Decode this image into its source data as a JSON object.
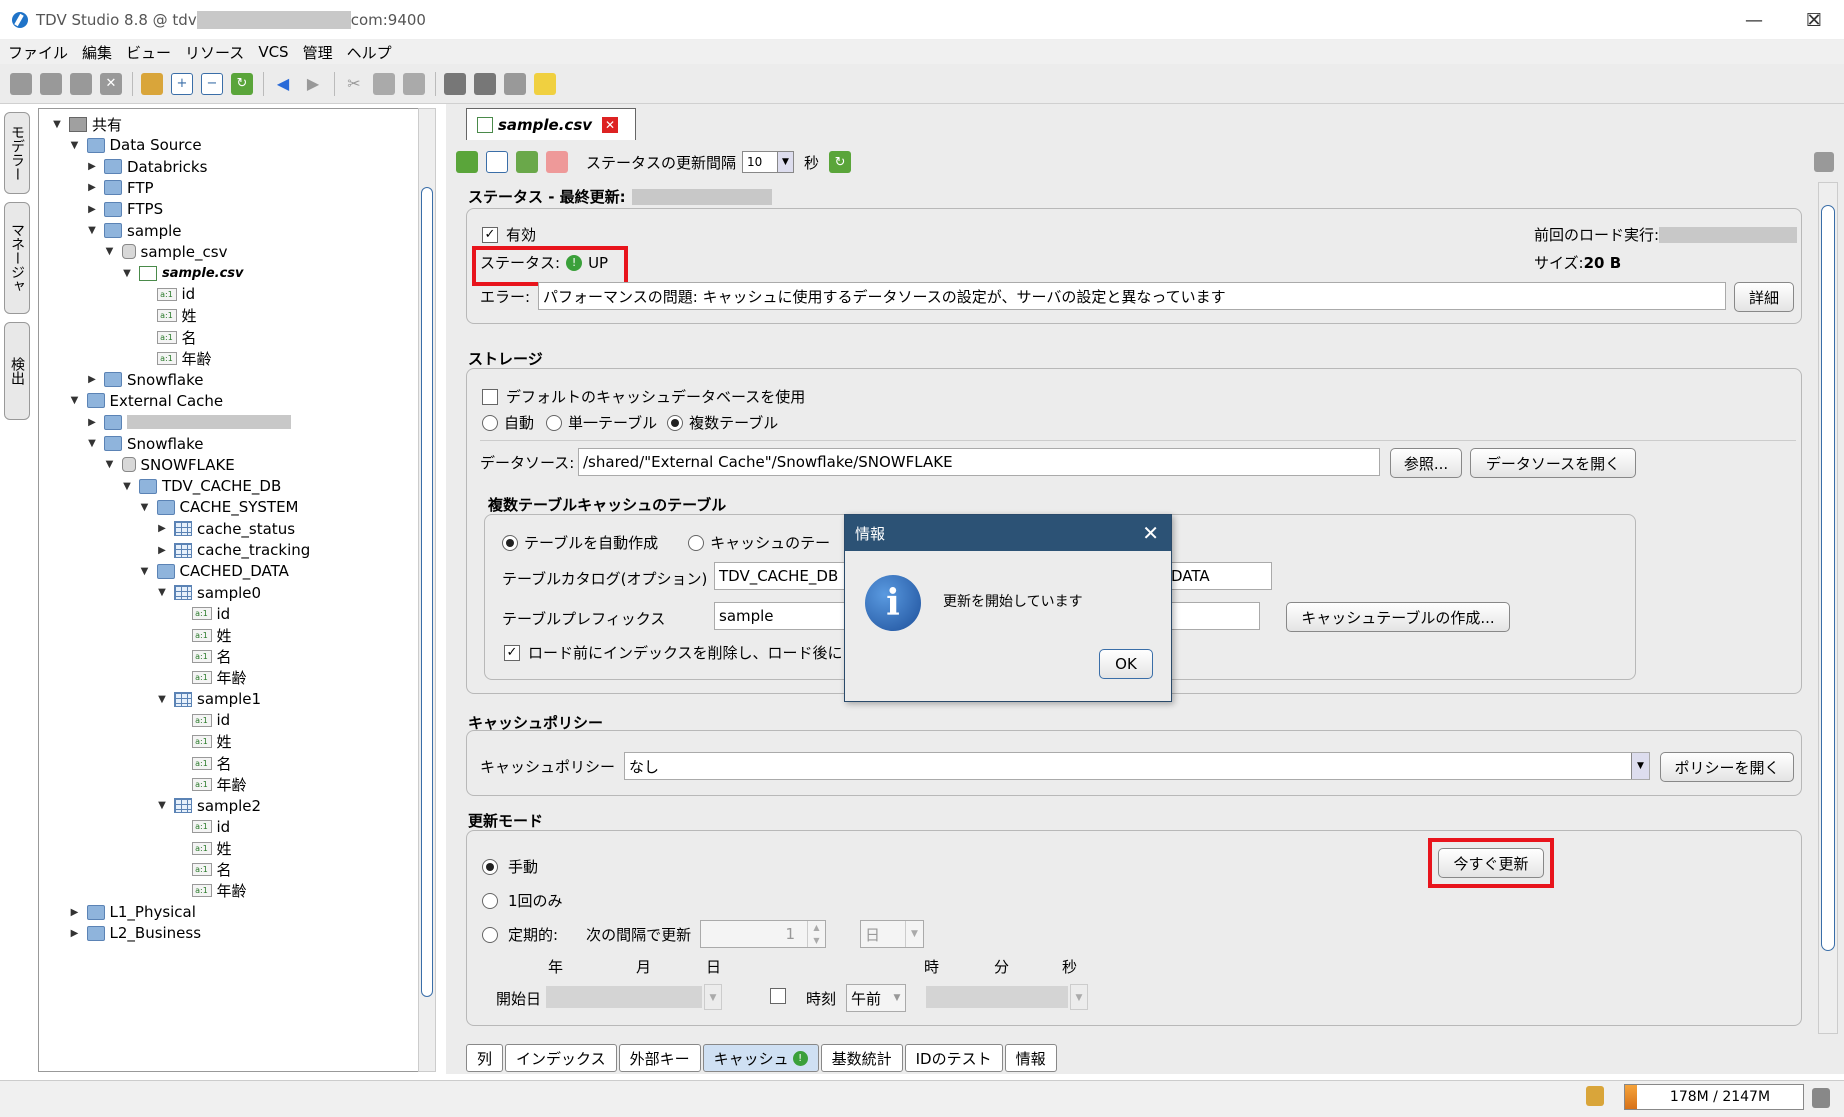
{
  "window": {
    "title_prefix": "TDV Studio 8.8 @ tdv",
    "title_suffix": "com:9400",
    "minimize": "—",
    "maximize": "☐",
    "close": "✕"
  },
  "menu": [
    "ファイル",
    "編集",
    "ビュー",
    "リソース",
    "VCS",
    "管理",
    "ヘルプ"
  ],
  "side_tabs": [
    "モデラー",
    "マネージャ",
    "検出"
  ],
  "tree": [
    {
      "label": "共有",
      "depth": 0,
      "icon": "shared",
      "toggle": "▼"
    },
    {
      "label": "Data Source",
      "depth": 1,
      "icon": "folder",
      "toggle": "▼"
    },
    {
      "label": "Databricks",
      "depth": 2,
      "icon": "folder",
      "toggle": "▶"
    },
    {
      "label": "FTP",
      "depth": 2,
      "icon": "folder",
      "toggle": "▶"
    },
    {
      "label": "FTPS",
      "depth": 2,
      "icon": "folder",
      "toggle": "▶"
    },
    {
      "label": "sample",
      "depth": 2,
      "icon": "folder",
      "toggle": "▼"
    },
    {
      "label": "sample_csv",
      "depth": 3,
      "icon": "db",
      "toggle": "▼"
    },
    {
      "label": "sample.csv",
      "depth": 4,
      "icon": "csv",
      "toggle": "▼",
      "style": "bold-italic"
    },
    {
      "label": "id",
      "depth": 5,
      "icon": "col",
      "toggle": ""
    },
    {
      "label": "姓",
      "depth": 5,
      "icon": "col",
      "toggle": ""
    },
    {
      "label": "名",
      "depth": 5,
      "icon": "col",
      "toggle": ""
    },
    {
      "label": "年齢",
      "depth": 5,
      "icon": "col",
      "toggle": ""
    },
    {
      "label": "Snowflake",
      "depth": 2,
      "icon": "folder",
      "toggle": "▶"
    },
    {
      "label": "External Cache",
      "depth": 1,
      "icon": "folder",
      "toggle": "▼"
    },
    {
      "label": "",
      "depth": 2,
      "icon": "folder",
      "toggle": "▶",
      "redacted": true
    },
    {
      "label": "Snowflake",
      "depth": 2,
      "icon": "folder",
      "toggle": "▼"
    },
    {
      "label": "SNOWFLAKE",
      "depth": 3,
      "icon": "db",
      "toggle": "▼"
    },
    {
      "label": "TDV_CACHE_DB",
      "depth": 4,
      "icon": "folder",
      "toggle": "▼"
    },
    {
      "label": "CACHE_SYSTEM",
      "depth": 5,
      "icon": "folder",
      "toggle": "▼"
    },
    {
      "label": "cache_status",
      "depth": 6,
      "icon": "tbl",
      "toggle": "▶"
    },
    {
      "label": "cache_tracking",
      "depth": 6,
      "icon": "tbl",
      "toggle": "▶"
    },
    {
      "label": "CACHED_DATA",
      "depth": 5,
      "icon": "folder",
      "toggle": "▼"
    },
    {
      "label": "sample0",
      "depth": 6,
      "icon": "tbl",
      "toggle": "▼"
    },
    {
      "label": "id",
      "depth": 7,
      "icon": "col",
      "toggle": ""
    },
    {
      "label": "姓",
      "depth": 7,
      "icon": "col",
      "toggle": ""
    },
    {
      "label": "名",
      "depth": 7,
      "icon": "col",
      "toggle": ""
    },
    {
      "label": "年齢",
      "depth": 7,
      "icon": "col",
      "toggle": ""
    },
    {
      "label": "sample1",
      "depth": 6,
      "icon": "tbl",
      "toggle": "▼"
    },
    {
      "label": "id",
      "depth": 7,
      "icon": "col",
      "toggle": ""
    },
    {
      "label": "姓",
      "depth": 7,
      "icon": "col",
      "toggle": ""
    },
    {
      "label": "名",
      "depth": 7,
      "icon": "col",
      "toggle": ""
    },
    {
      "label": "年齢",
      "depth": 7,
      "icon": "col",
      "toggle": ""
    },
    {
      "label": "sample2",
      "depth": 6,
      "icon": "tbl",
      "toggle": "▼"
    },
    {
      "label": "id",
      "depth": 7,
      "icon": "col",
      "toggle": ""
    },
    {
      "label": "姓",
      "depth": 7,
      "icon": "col",
      "toggle": ""
    },
    {
      "label": "名",
      "depth": 7,
      "icon": "col",
      "toggle": ""
    },
    {
      "label": "年齢",
      "depth": 7,
      "icon": "col",
      "toggle": ""
    },
    {
      "label": "L1_Physical",
      "depth": 1,
      "icon": "folder",
      "toggle": "▶"
    },
    {
      "label": "L2_Business",
      "depth": 1,
      "icon": "folder",
      "toggle": "▶"
    }
  ],
  "editor_tab": {
    "title": "sample.csv",
    "close": "✕"
  },
  "ed_toolbar": {
    "interval_label": "ステータスの更新間隔",
    "interval_value": "10",
    "unit": "秒"
  },
  "status_section": {
    "header": "ステータス - 最終更新:",
    "enabled_label": "有効",
    "status_label": "ステータス:",
    "status_value": "UP",
    "last_load_label": "前回のロード実行:",
    "size_label": "サイズ:",
    "size_value": "20 B",
    "error_label": "エラー:",
    "error_value": "パフォーマンスの問題: キャッシュに使用するデータソースの設定が、サーバの設定と異なっています",
    "detail_button": "詳細"
  },
  "storage": {
    "header": "ストレージ",
    "default_db_label": "デフォルトのキャッシュデータベースを使用",
    "radio_auto": "自動",
    "radio_single": "単一テーブル",
    "radio_multi": "複数テーブル",
    "datasource_label": "データソース:",
    "datasource_value": "/shared/\"External Cache\"/Snowflake/SNOWFLAKE",
    "browse_button": "参照...",
    "open_ds_button": "データソースを開く",
    "multi_header": "複数テーブルキャッシュのテーブル",
    "radio_autocreate": "テーブルを自動作成",
    "radio_cache_table": "キャッシュのテー",
    "catalog_label": "テーブルカタログ(オプション)",
    "catalog_value": "TDV_CACHE_DB",
    "schema_value": "DATA",
    "prefix_label": "テーブルプレフィックス",
    "prefix_value": "sample",
    "create_button": "キャッシュテーブルの作成...",
    "index_label": "ロード前にインデックスを削除し、ロード後に"
  },
  "policy": {
    "header": "キャッシュポリシー",
    "label": "キャッシュポリシー",
    "value": "なし",
    "open_button": "ポリシーを開く"
  },
  "refresh": {
    "header": "更新モード",
    "manual": "手動",
    "once": "1回のみ",
    "periodic": "定期的:",
    "interval_label": "次の間隔で更新",
    "interval_value": "1",
    "unit_value": "日",
    "refresh_now_button": "今すぐ更新",
    "col_year": "年",
    "col_month": "月",
    "col_day": "日",
    "col_hour": "時",
    "col_min": "分",
    "col_sec": "秒",
    "start_label": "開始日",
    "time_label": "時刻",
    "ampm": "午前"
  },
  "bottom_tabs": [
    "列",
    "インデックス",
    "外部キー",
    "キャッシュ",
    "基数統計",
    "IDのテスト",
    "情報"
  ],
  "memory": "178M / 2147M",
  "dialog": {
    "title": "情報",
    "message": "更新を開始しています",
    "ok": "OK",
    "close": "✕"
  },
  "colors": {
    "highlight": "#e8141c",
    "dialog_header": "#2c5275",
    "status_ok": "#3aa03a"
  }
}
